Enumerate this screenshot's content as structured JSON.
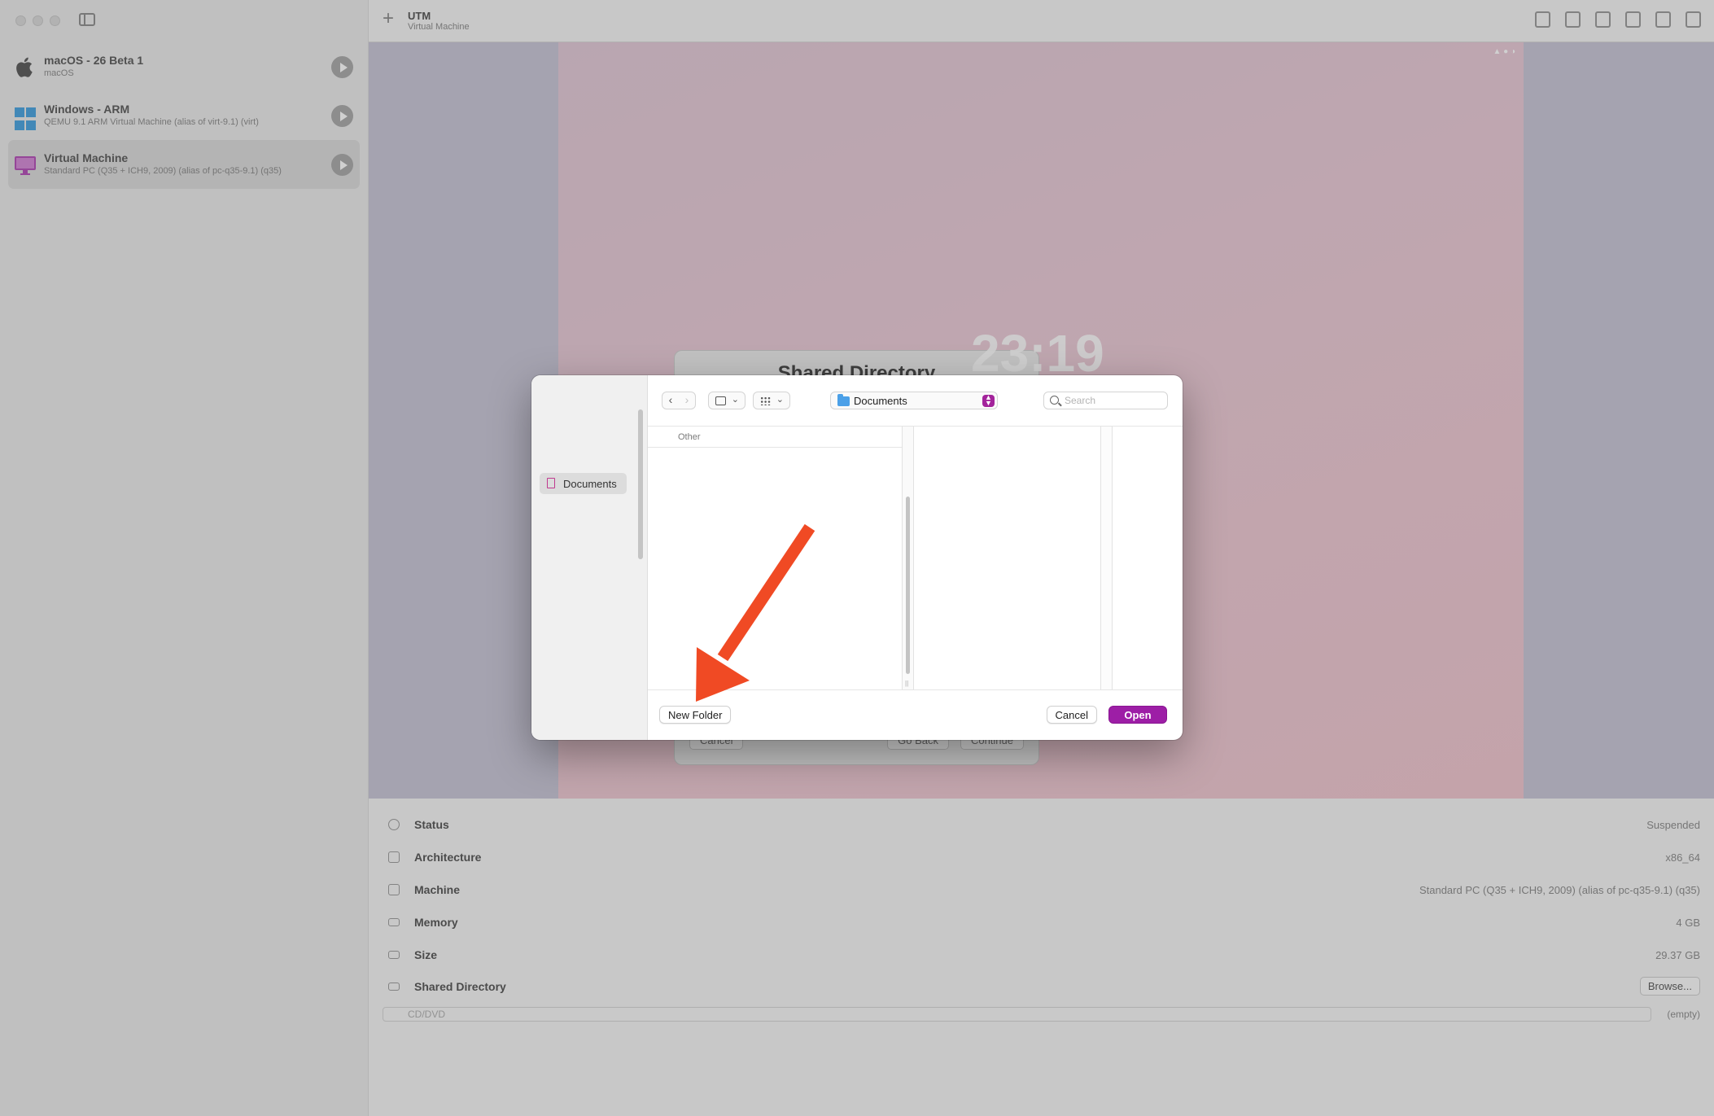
{
  "sidebar": {
    "vms": [
      {
        "name": "macOS - 26 Beta 1",
        "subtitle": "macOS",
        "icon": "apple-icon"
      },
      {
        "name": "Windows - ARM",
        "subtitle": "QEMU 9.1 ARM Virtual Machine (alias of virt-9.1) (virt)",
        "icon": "windows-icon"
      },
      {
        "name": "Virtual Machine",
        "subtitle": "Standard PC (Q35 + ICH9, 2009) (alias of pc-q35-9.1) (q35)",
        "icon": "monitor-icon"
      }
    ]
  },
  "header": {
    "title": "UTM",
    "subtitle": "Virtual Machine",
    "icons": [
      "trash-icon",
      "clone-icon",
      "new-document-icon",
      "share-icon",
      "stop-icon",
      "settings-icon"
    ]
  },
  "vm_screen": {
    "clock": "23:19",
    "sheet_title": "Shared Directory",
    "sheet_cancel": "Cancel",
    "sheet_goback": "Go Back",
    "sheet_continue": "Continue"
  },
  "details": {
    "rows": [
      {
        "label": "Status",
        "value": "Suspended",
        "icon": "info-icon"
      },
      {
        "label": "Architecture",
        "value": "x86_64",
        "icon": "cpu-icon"
      },
      {
        "label": "Machine",
        "value": "Standard PC (Q35 + ICH9, 2009) (alias of pc-q35-9.1) (q35)",
        "icon": "monitor-icon"
      },
      {
        "label": "Memory",
        "value": "4 GB",
        "icon": "memory-icon"
      },
      {
        "label": "Size",
        "value": "29.37 GB",
        "icon": "disk-icon"
      },
      {
        "label": "Shared Directory",
        "value": "Browse...",
        "icon": "folder-share-icon"
      }
    ],
    "cd": {
      "label": "CD/DVD",
      "value": "(empty)"
    }
  },
  "dialog": {
    "sidebar_item": "Documents",
    "path": "Documents",
    "search_placeholder": "Search",
    "column_header": "Other",
    "new_folder": "New Folder",
    "cancel": "Cancel",
    "open": "Open",
    "accent": "#9d1ea6"
  },
  "annotation": {
    "color": "#f04a24",
    "target": "New Folder"
  }
}
